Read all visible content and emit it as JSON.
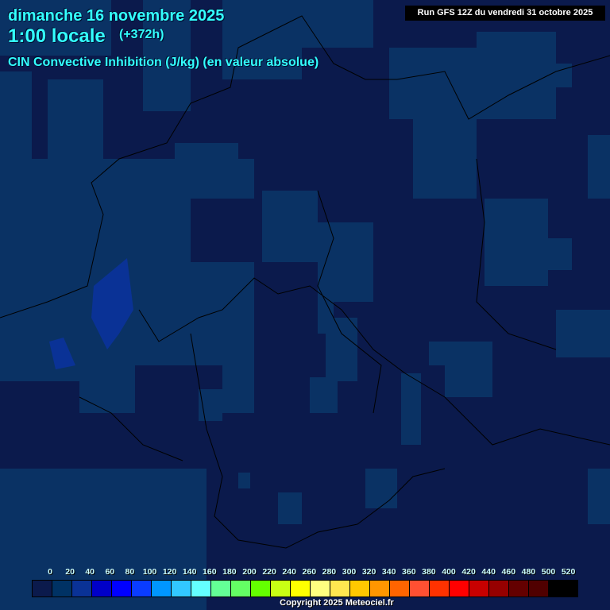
{
  "header": {
    "date": "dimanche 16 novembre 2025",
    "time": "1:00 locale",
    "lead": "(+372h)",
    "parameter": "CIN Convective Inhibition (J/kg) (en valeur absolue)",
    "run": "Run GFS 12Z du vendredi 31 octobre 2025"
  },
  "legend": {
    "labels": [
      "0",
      "20",
      "40",
      "60",
      "80",
      "100",
      "120",
      "140",
      "160",
      "180",
      "200",
      "220",
      "240",
      "260",
      "280",
      "300",
      "320",
      "340",
      "360",
      "380",
      "400",
      "420",
      "440",
      "460",
      "480",
      "500",
      "520"
    ],
    "colors": [
      "#0b1a4c",
      "#003264",
      "#0a3296",
      "#0000c8",
      "#0000ff",
      "#0a3cff",
      "#0096ff",
      "#32c8ff",
      "#64ffff",
      "#64ff96",
      "#64ff64",
      "#64ff00",
      "#c8ff14",
      "#ffff00",
      "#ffff80",
      "#ffe650",
      "#ffc800",
      "#ff9600",
      "#ff6400",
      "#ff5032",
      "#ff3200",
      "#ff0000",
      "#c80000",
      "#960000",
      "#640000",
      "#500000",
      "#000000"
    ]
  },
  "copyright": "Copyright 2025 Meteociel.fr"
}
